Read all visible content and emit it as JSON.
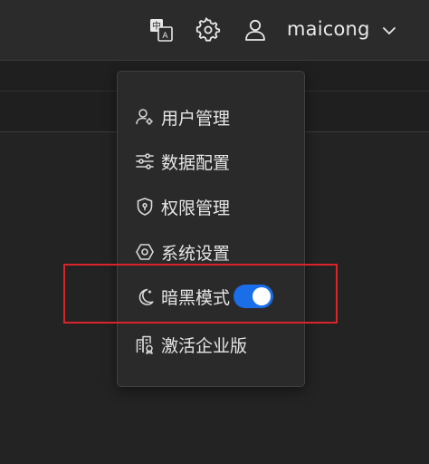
{
  "header": {
    "username": "maicong",
    "icons": {
      "translate": "translate-icon",
      "settings": "gear-icon",
      "user": "user-icon",
      "chevron": "chevron-down-icon"
    },
    "translate_glyph_top": "中",
    "translate_glyph_bottom": "A"
  },
  "menu": {
    "items": [
      {
        "label": "用户管理",
        "icon": "user-manage-icon"
      },
      {
        "label": "数据配置",
        "icon": "sliders-icon"
      },
      {
        "label": "权限管理",
        "icon": "shield-icon"
      },
      {
        "label": "系统设置",
        "icon": "hexagon-icon"
      },
      {
        "label": "暗黑模式",
        "icon": "moon-icon",
        "toggle_on": true
      },
      {
        "label": "激活企业版",
        "icon": "building-icon"
      }
    ]
  },
  "colors": {
    "toggle_on": "#1a6ee8",
    "highlight_border": "#d9252a"
  }
}
